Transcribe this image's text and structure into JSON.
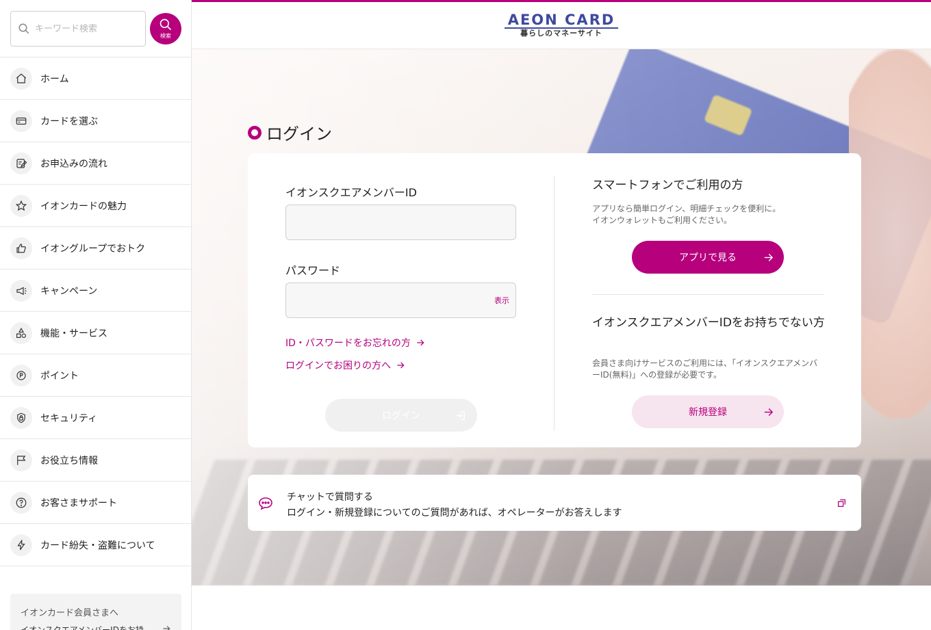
{
  "search": {
    "placeholder": "キーワード検索",
    "button_label": "検索"
  },
  "sidebar": {
    "items": [
      {
        "label": "ホーム",
        "icon": "home-icon"
      },
      {
        "label": "カードを選ぶ",
        "icon": "card-icon"
      },
      {
        "label": "お申込みの流れ",
        "icon": "form-edit-icon"
      },
      {
        "label": "イオンカードの魅力",
        "icon": "star-icon"
      },
      {
        "label": "イオングループでおトク",
        "icon": "thumbs-up-icon"
      },
      {
        "label": "キャンペーン",
        "icon": "megaphone-icon"
      },
      {
        "label": "機能・サービス",
        "icon": "shapes-icon"
      },
      {
        "label": "ポイント",
        "icon": "point-icon"
      },
      {
        "label": "セキュリティ",
        "icon": "lock-icon"
      },
      {
        "label": "お役立ち情報",
        "icon": "flag-icon"
      },
      {
        "label": "お客さまサポート",
        "icon": "question-icon"
      },
      {
        "label": "カード紛失・盗難について",
        "icon": "lightning-icon"
      }
    ],
    "member_box": {
      "title": "イオンカード会員さまへ",
      "subtitle": "イオンスクエアメンバーIDをお持"
    }
  },
  "header": {
    "logo_main": "AEON CARD",
    "logo_sub": "暮らしのマネーサイト"
  },
  "login": {
    "title": "ログイン",
    "id_label": "イオンスクエアメンバーID",
    "password_label": "パスワード",
    "show_label": "表示",
    "forgot_link": "ID・パスワードをお忘れの方",
    "trouble_link": "ログインでお困りの方へ",
    "login_button": "ログイン"
  },
  "app_section": {
    "title": "スマートフォンでご利用の方",
    "desc_line1": "アプリなら簡単ログイン、明細チェックを便利に。",
    "desc_line2": "イオンウォレットもご利用ください。",
    "button": "アプリで見る"
  },
  "register_section": {
    "title": "イオンスクエアメンバーIDをお持ちでない方",
    "desc": "会員さま向けサービスのご利用には、「イオンスクエアメンバーID(無料)」への登録が必要です。",
    "button": "新規登録"
  },
  "chat": {
    "title": "チャットで質問する",
    "desc": "ログイン・新規登録についてのご質問があれば、オペレーターがお答えします"
  },
  "colors": {
    "accent": "#b6007c",
    "brand_blue": "#3e4a9e",
    "accent_light": "#f6e4ef"
  }
}
